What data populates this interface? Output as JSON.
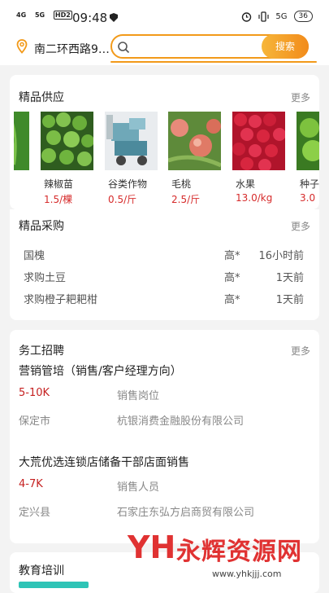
{
  "status_bar": {
    "signal1": "4G",
    "signal2": "5G",
    "hd": "HD2",
    "time": "09:48",
    "net": "5G",
    "battery": "36"
  },
  "search": {
    "location": "南二环西路9…",
    "placeholder": "",
    "button": "搜索"
  },
  "featured_supply": {
    "title": "精品供应",
    "more": "更多",
    "items": [
      {
        "name": "",
        "price": "",
        "image": "green-leaf-image"
      },
      {
        "name": "辣椒苗",
        "price": "1.5/棵",
        "image": "pepper-seedlings-image"
      },
      {
        "name": "谷类作物",
        "price": "0.5/斤",
        "image": "grain-machine-image"
      },
      {
        "name": "毛桃",
        "price": "2.5/斤",
        "image": "peach-image"
      },
      {
        "name": "水果",
        "price": "13.0/kg",
        "image": "raspberry-image"
      },
      {
        "name": "种子",
        "price": "3.0",
        "image": "green-fruit-image"
      }
    ]
  },
  "featured_purchase": {
    "title": "精品采购",
    "more": "更多",
    "rows": [
      {
        "name": "国槐",
        "price": "高*",
        "time": "16小时前"
      },
      {
        "name": "求购土豆",
        "price": "高*",
        "time": "1天前"
      },
      {
        "name": "求购橙子耙耙柑",
        "price": "高*",
        "time": "1天前"
      }
    ]
  },
  "jobs": {
    "title": "务工招聘",
    "more": "更多",
    "list": [
      {
        "title": "营销管培（销售/客户经理方向）",
        "salary": "5-10K",
        "position": "销售岗位",
        "city": "保定市",
        "company": "杭银消费金融股份有限公司"
      },
      {
        "title": "大荒优选连锁店储备干部店面销售",
        "salary": "4-7K",
        "position": "销售人员",
        "city": "定兴县",
        "company": "石家庄东弘方启商贸有限公司"
      }
    ]
  },
  "education": {
    "title": "教育培训"
  },
  "watermark": {
    "logo": "YH",
    "name": "永辉资源网",
    "url": "www.yhkjjj.com"
  },
  "colors": {
    "accent": "#f29a1a",
    "price": "#d62b2b"
  }
}
